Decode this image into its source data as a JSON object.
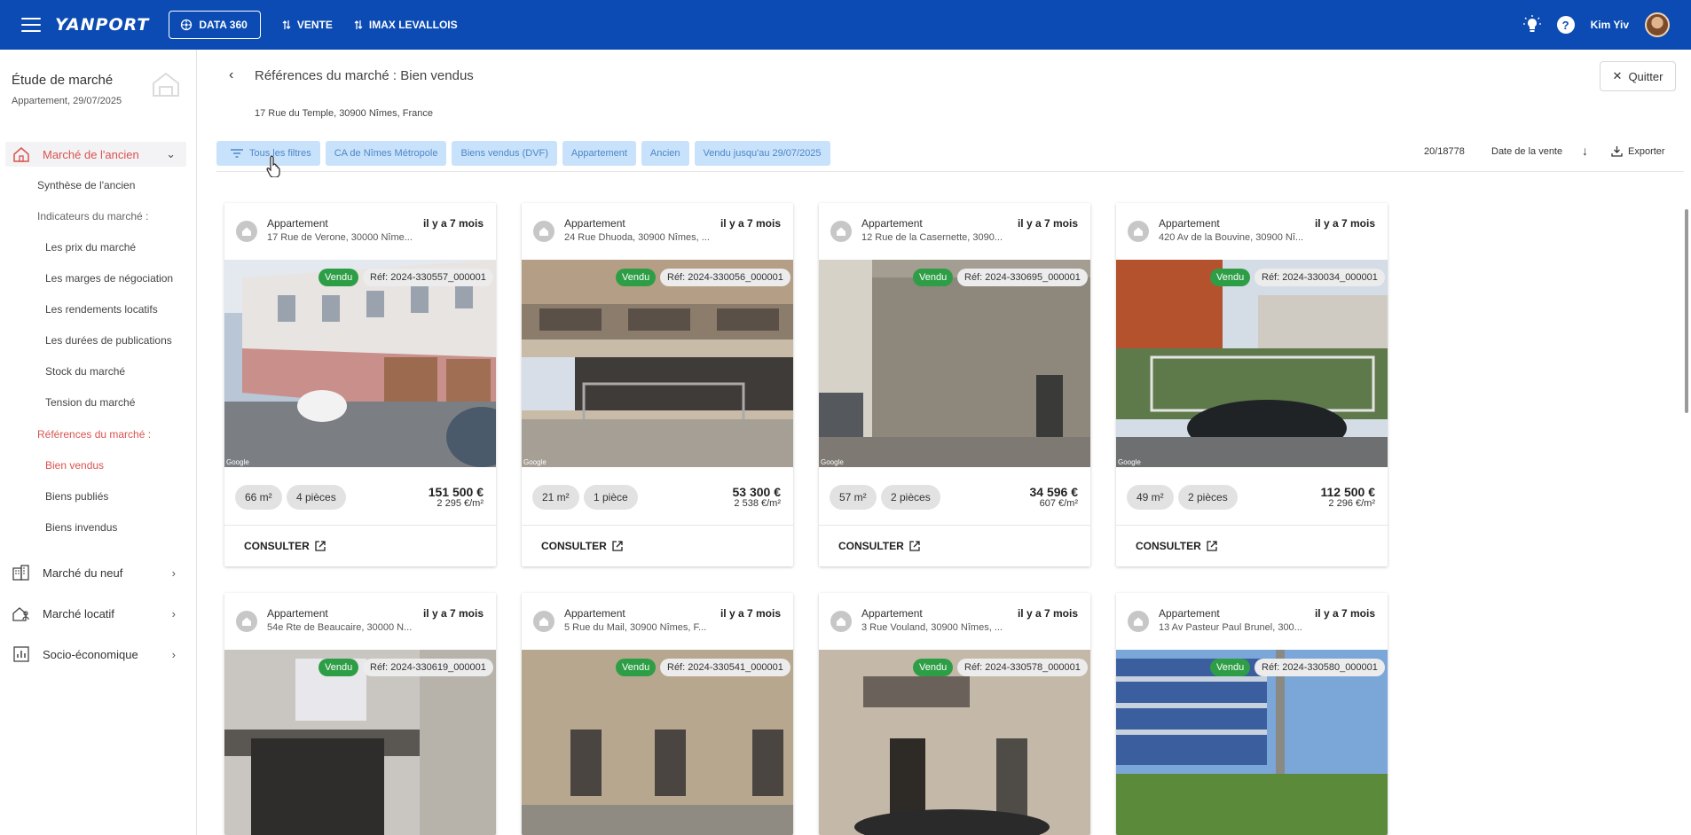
{
  "header": {
    "logo": "YANPORT",
    "data_btn": "DATA 360",
    "nav": [
      "VENTE",
      "IMAX LEVALLOIS"
    ],
    "user": "Kim Yiv",
    "help": "?"
  },
  "sidebar": {
    "title": "Étude de marché",
    "subtitle": "Appartement, 29/07/2025",
    "sections": {
      "ancien": "Marché de l'ancien",
      "neuf": "Marché du neuf",
      "locatif": "Marché locatif",
      "socio": "Socio-économique"
    },
    "links": {
      "synthese": "Synthèse de l'ancien",
      "indicateurs": "Indicateurs du marché :",
      "prix": "Les prix du marché",
      "marges": "Les marges de négociation",
      "rendements": "Les rendements locatifs",
      "durees": "Les durées de publications",
      "stock": "Stock du marché",
      "tension": "Tension du marché",
      "references": "Références du marché :",
      "vendus": "Bien vendus",
      "publies": "Biens publiés",
      "invendus": "Biens invendus"
    }
  },
  "main": {
    "title": "Références du marché : Bien vendus",
    "address": "17 Rue du Temple, 30900 Nîmes, France",
    "quit": "Quitter",
    "filters": {
      "all": "Tous les filtres",
      "chips": [
        "CA de Nîmes Métropole",
        "Biens vendus (DVF)",
        "Appartement",
        "Ancien",
        "Vendu jusqu'au 29/07/2025"
      ]
    },
    "count": "20/18778",
    "sort": "Date de la vente",
    "export": "Exporter"
  },
  "cards": [
    {
      "type": "Appartement",
      "addr": "17 Rue de Verone, 30000 Nîme...",
      "age": "il y a 7 mois",
      "badge": "Vendu",
      "ref": "Réf: 2024-330557_000001",
      "surface": "66 m²",
      "rooms": "4 pièces",
      "price": "151 500 €",
      "ppm": "2 295 €/m²",
      "cta": "CONSULTER"
    },
    {
      "type": "Appartement",
      "addr": "24 Rue Dhuoda, 30900 Nîmes, ...",
      "age": "il y a 7 mois",
      "badge": "Vendu",
      "ref": "Réf: 2024-330056_000001",
      "surface": "21 m²",
      "rooms": "1 pièce",
      "price": "53 300 €",
      "ppm": "2 538 €/m²",
      "cta": "CONSULTER"
    },
    {
      "type": "Appartement",
      "addr": "12 Rue de la Casernette, 3090...",
      "age": "il y a 7 mois",
      "badge": "Vendu",
      "ref": "Réf: 2024-330695_000001",
      "surface": "57 m²",
      "rooms": "2 pièces",
      "price": "34 596 €",
      "ppm": "607 €/m²",
      "cta": "CONSULTER"
    },
    {
      "type": "Appartement",
      "addr": "420 Av de la Bouvine, 30900 Nî...",
      "age": "il y a 7 mois",
      "badge": "Vendu",
      "ref": "Réf: 2024-330034_000001",
      "surface": "49 m²",
      "rooms": "2 pièces",
      "price": "112 500 €",
      "ppm": "2 296 €/m²",
      "cta": "CONSULTER"
    },
    {
      "type": "Appartement",
      "addr": "54e Rte de Beaucaire, 30000 N...",
      "age": "il y a 7 mois",
      "badge": "Vendu",
      "ref": "Réf: 2024-330619_000001"
    },
    {
      "type": "Appartement",
      "addr": "5 Rue du Mail, 30900 Nîmes, F...",
      "age": "il y a 7 mois",
      "badge": "Vendu",
      "ref": "Réf: 2024-330541_000001"
    },
    {
      "type": "Appartement",
      "addr": "3 Rue Vouland, 30900 Nîmes, ...",
      "age": "il y a 7 mois",
      "badge": "Vendu",
      "ref": "Réf: 2024-330578_000001"
    },
    {
      "type": "Appartement",
      "addr": "13 Av Pasteur Paul Brunel, 300...",
      "age": "il y a 7 mois",
      "badge": "Vendu",
      "ref": "Réf: 2024-330580_000001"
    }
  ],
  "google_mark": "Google",
  "colors": {
    "brand": "#0b4bb3",
    "accent": "#d9534f",
    "chip_bg": "#c9e2fb",
    "sold": "#2e9e46"
  }
}
